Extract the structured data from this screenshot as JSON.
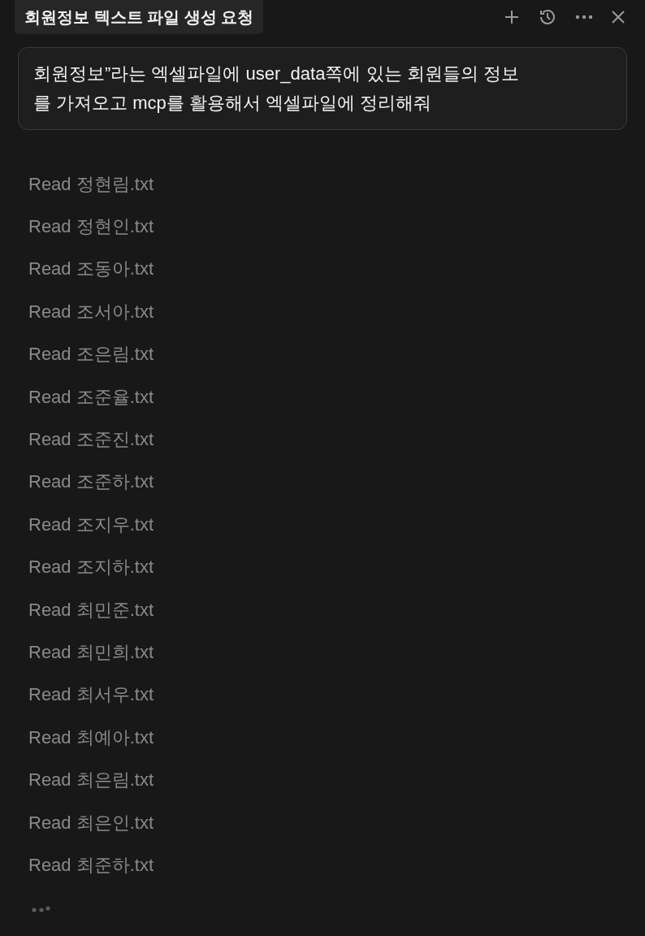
{
  "tab": {
    "title": "회원정보 텍스트 파일 생성 요청"
  },
  "prompt": {
    "lines": [
      "회원정보”라는 엑셀파일에 user_data쪽에 있는 회원들의 정보",
      "를 가져오고 mcp를 활용해서 엑셀파일에 정리해줘"
    ]
  },
  "steps": [
    {
      "action": "Read",
      "file": "정현림.txt"
    },
    {
      "action": "Read",
      "file": "정현인.txt"
    },
    {
      "action": "Read",
      "file": "조동아.txt"
    },
    {
      "action": "Read",
      "file": "조서아.txt"
    },
    {
      "action": "Read",
      "file": "조은림.txt"
    },
    {
      "action": "Read",
      "file": "조준율.txt"
    },
    {
      "action": "Read",
      "file": "조준진.txt"
    },
    {
      "action": "Read",
      "file": "조준하.txt"
    },
    {
      "action": "Read",
      "file": "조지우.txt"
    },
    {
      "action": "Read",
      "file": "조지하.txt"
    },
    {
      "action": "Read",
      "file": "최민준.txt"
    },
    {
      "action": "Read",
      "file": "최민희.txt"
    },
    {
      "action": "Read",
      "file": "최서우.txt"
    },
    {
      "action": "Read",
      "file": "최예아.txt"
    },
    {
      "action": "Read",
      "file": "최은림.txt"
    },
    {
      "action": "Read",
      "file": "최은인.txt"
    },
    {
      "action": "Read",
      "file": "최준하.txt"
    }
  ]
}
